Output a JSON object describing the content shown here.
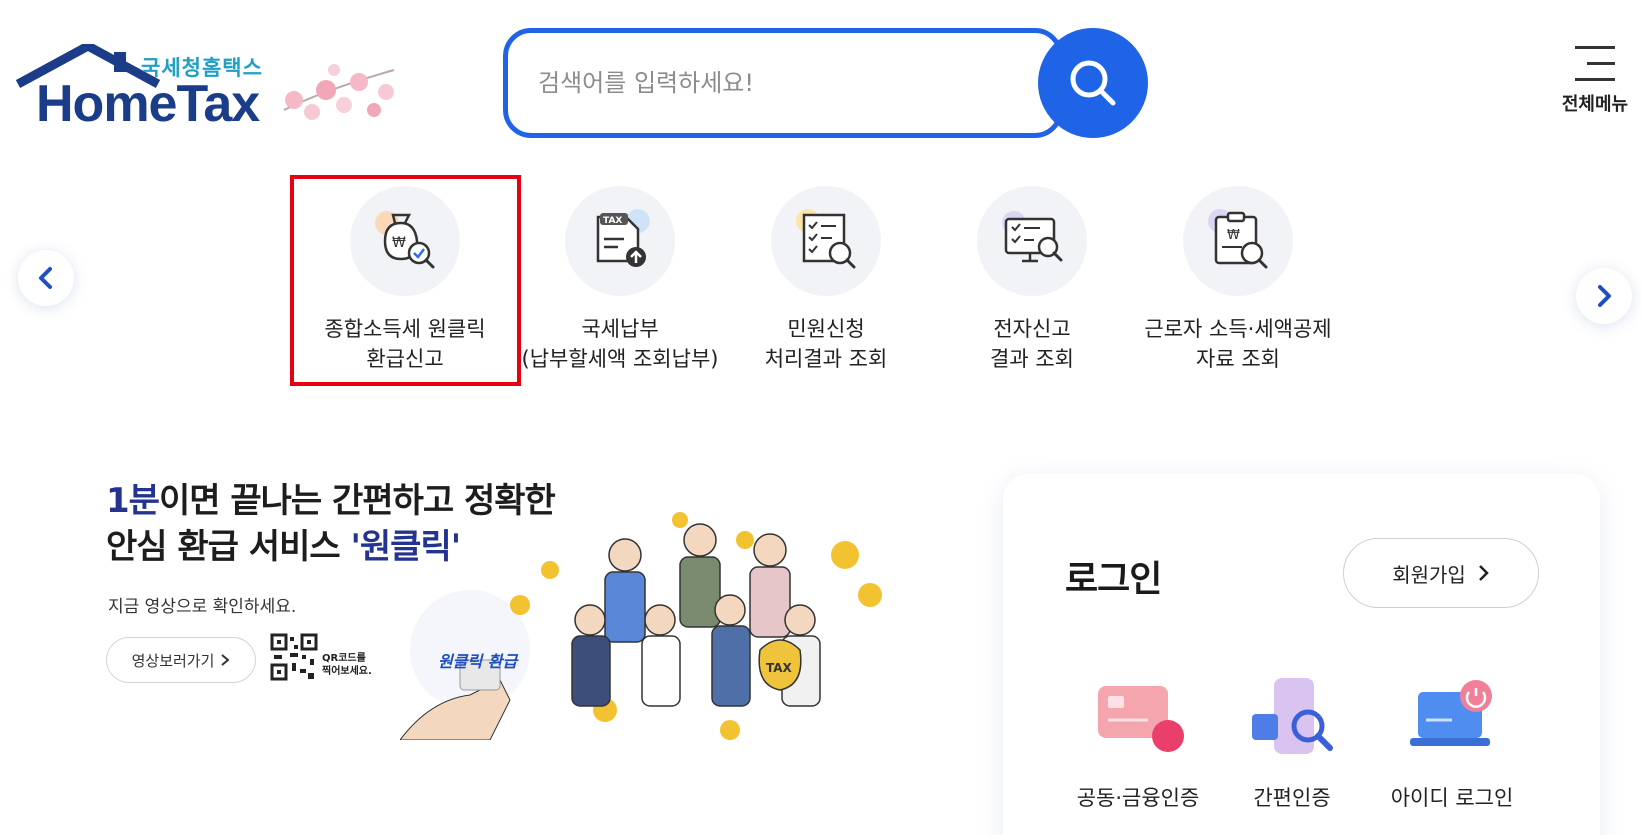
{
  "header": {
    "logo_subtitle": "국세청홈택스",
    "logo_title": "HomeTax",
    "search_placeholder": "검색어를 입력하세요!",
    "menu_label": "전체메뉴"
  },
  "quick_menu": {
    "items": [
      {
        "line1": "종합소득세 원클릭",
        "line2": "환급신고",
        "icon": "money-bag-search-icon",
        "highlighted": true
      },
      {
        "line1": "국세납부",
        "line2": "(납부할세액 조회납부)",
        "icon": "tax-document-upload-icon",
        "highlighted": false
      },
      {
        "line1": "민원신청",
        "line2": "처리결과 조회",
        "icon": "checklist-search-icon",
        "highlighted": false
      },
      {
        "line1": "전자신고",
        "line2": "결과 조회",
        "icon": "monitor-search-icon",
        "highlighted": false
      },
      {
        "line1": "근로자 소득·세액공제",
        "line2": "자료 조회",
        "icon": "clipboard-search-icon",
        "highlighted": false
      }
    ]
  },
  "banner": {
    "title_highlight": "1분",
    "title_line1_rest": "이면 끝나는 간편하고 정확한",
    "title_line2_prefix": "안심 환급 서비스 ",
    "title_line2_highlight": "'원클릭'",
    "description": "지금 영상으로 확인하세요.",
    "video_button": "영상보러가기",
    "qr_text_1": "QR코드를",
    "qr_text_2": "찍어보세요.",
    "art_tag": "원클릭 환급",
    "art_badge": "TAX"
  },
  "login": {
    "title": "로그인",
    "signup_button": "회원가입",
    "options": [
      {
        "label": "공동·금융인증",
        "icon": "certificate-card-icon"
      },
      {
        "label": "간편인증",
        "icon": "phone-search-icon"
      },
      {
        "label": "아이디 로그인",
        "icon": "laptop-power-icon"
      }
    ]
  },
  "colors": {
    "primary": "#1f63e6",
    "brand_dark": "#1b3c88",
    "brand_light": "#1fa0c4",
    "highlight_border": "#e60012",
    "title_highlight": "#23338f"
  }
}
